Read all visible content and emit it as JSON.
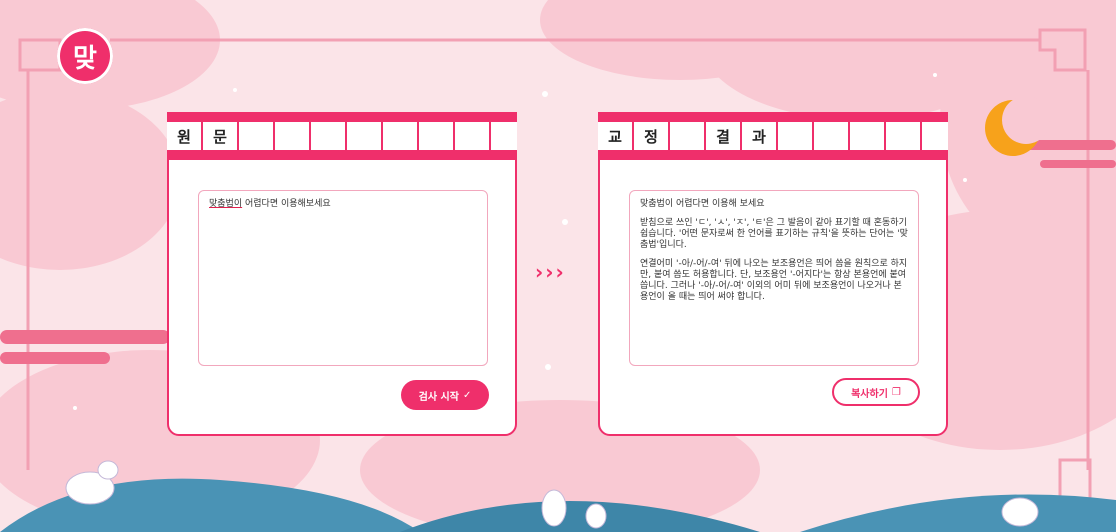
{
  "logo": {
    "text": "맞"
  },
  "original": {
    "title_chars": [
      "원",
      "문",
      "",
      "",
      "",
      "",
      "",
      "",
      "",
      ""
    ],
    "text_error": "맞춤법이",
    "text_rest": " 어렵다면 이용해보세요",
    "button_label": "검사 시작",
    "button_icon": "check-icon"
  },
  "result": {
    "title_chars": [
      "교",
      "정",
      "",
      "결",
      "과",
      "",
      "",
      "",
      "",
      ""
    ],
    "paragraph1": "맞춤법이 어렵다면 이용해 보세요",
    "paragraph2": "받침으로 쓰인 'ㄷ', 'ㅅ', 'ㅈ', 'ㅌ'은 그 발음이 같아 표기할 때 혼동하기 쉽습니다. '어떤 문자로써 한 언어를 표기하는 규칙'을 뜻하는 단어는 '맞춤법'입니다.",
    "paragraph3": "연결어미 '-아/-어/-여' 뒤에 나오는 보조용언은 띄어 씀을 원칙으로 하지만, 붙여 씀도 허용합니다. 단, 보조용언 '-어지다'는 항상 본용언에 붙여 씁니다. 그러나 '-아/-어/-여' 이외의 어미 뒤에 보조용언이 나오거나 본용언이 올 때는 띄어 써야 합니다.",
    "button_label": "복사하기",
    "button_icon": "copy-icon"
  },
  "arrows": "›››",
  "colors": {
    "accent": "#ef2f6b",
    "background": "#fbe4e8",
    "cloud": "#f9c9d3",
    "hill": "#4a93b5",
    "moon": "#f7a21b"
  }
}
